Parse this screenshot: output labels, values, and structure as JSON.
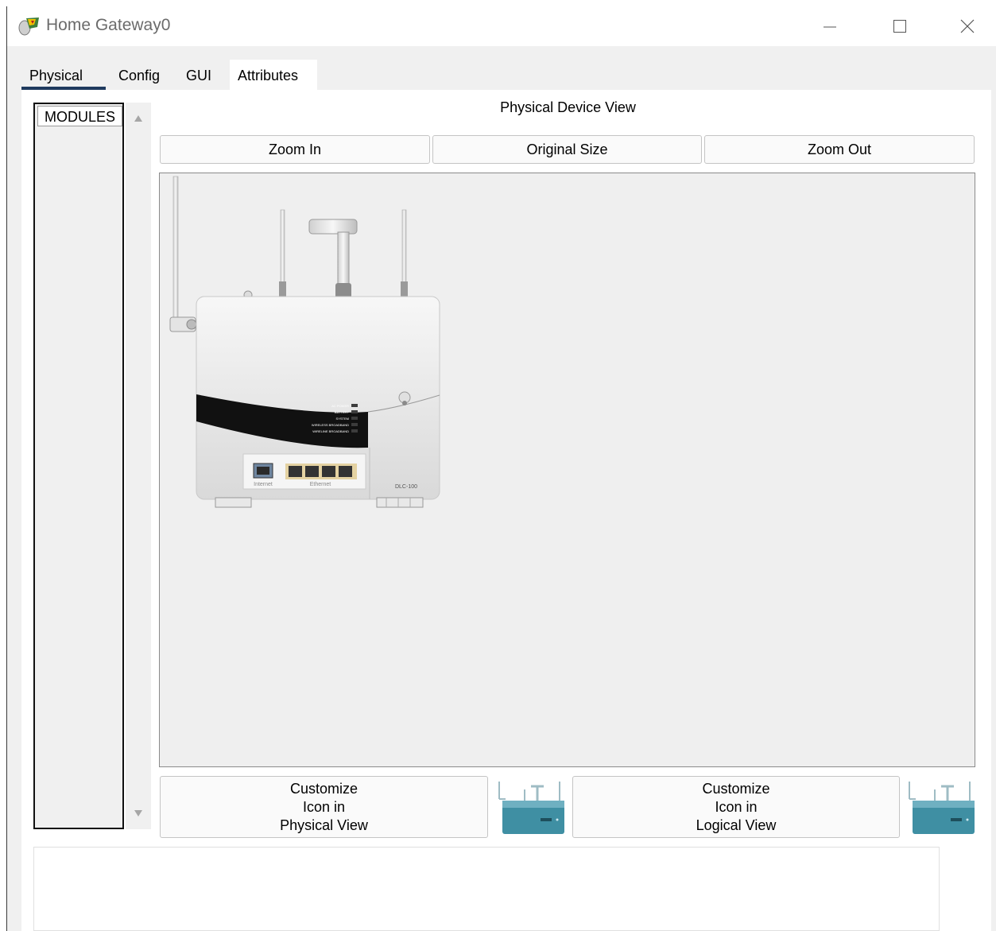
{
  "window": {
    "title": "Home Gateway0",
    "app_icon": "packet-tracer-icon",
    "controls": [
      "minimize-icon",
      "maximize-icon",
      "close-icon"
    ]
  },
  "tabs": [
    {
      "label": "Physical",
      "active": true
    },
    {
      "label": "Config",
      "active": false
    },
    {
      "label": "GUI",
      "active": false
    },
    {
      "label": "Attributes",
      "active": false
    }
  ],
  "modules": {
    "label": "MODULES"
  },
  "physical_view": {
    "title": "Physical Device View",
    "zoom_in": "Zoom In",
    "original_size": "Original Size",
    "zoom_out": "Zoom Out",
    "device": {
      "led_labels": [
        "AC POWER",
        "BATTERY",
        "SYSTEM",
        "WIRELESS BROADBAND",
        "WIRELINE BROADBAND"
      ],
      "port_internet": "Internet",
      "port_ethernet": "Ethernet",
      "model": "DLC-100"
    }
  },
  "customize": {
    "physical": {
      "line1": "Customize",
      "line2": "Icon in",
      "line3": "Physical View"
    },
    "logical": {
      "line1": "Customize",
      "line2": "Icon in",
      "line3": "Logical View"
    }
  },
  "colors": {
    "tab_underline": "#1f3a5e",
    "device_icon_teal": "#3f8fa3",
    "background": "#f0f0f0"
  }
}
